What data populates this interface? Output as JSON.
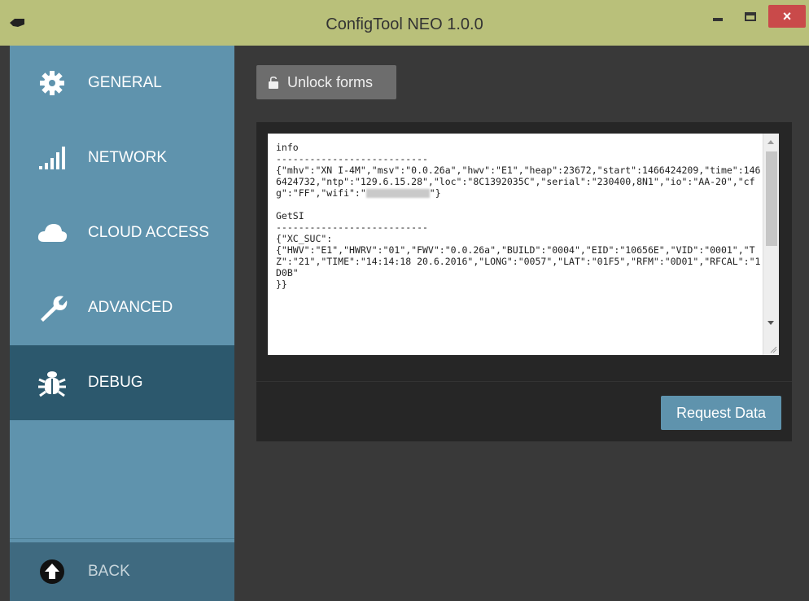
{
  "window": {
    "title": "ConfigTool NEO 1.0.0",
    "close_label": "×",
    "colors": {
      "titlebar": "#b9c07a",
      "sidebar": "#5f93ad",
      "sidebar_active": "#2c586d",
      "main": "#393939",
      "close": "#c94a4a"
    }
  },
  "sidebar": {
    "items": [
      {
        "label": "GENERAL",
        "icon": "gear-icon"
      },
      {
        "label": "NETWORK",
        "icon": "signal-bars-icon"
      },
      {
        "label": "CLOUD ACCESS",
        "icon": "cloud-icon"
      },
      {
        "label": "ADVANCED",
        "icon": "wrench-icon"
      },
      {
        "label": "DEBUG",
        "icon": "bug-icon",
        "active": true
      }
    ],
    "back": {
      "label": "BACK",
      "icon": "arrow-up-circle-icon"
    }
  },
  "main": {
    "unlock_button": {
      "label": "Unlock forms",
      "icon": "lock-icon"
    },
    "debug_output": {
      "line1": "info",
      "line2": "---------------------------",
      "line3a": "{\"mhv\":\"XN I-4M\",\"msv\":\"0.0.26a\",\"hwv\":\"E1\",\"heap\":23672,\"start\":1466424209,\"time\":1466424732,\"ntp\":\"129.6.15.28\",\"loc\":\"8C1392035C\",\"serial\":\"230400,8N1\",\"io\":\"AA-20\",\"cfg\":\"FF\",\"wifi\":\"",
      "line3b": "\"}",
      "line4": "",
      "line5": "GetSI",
      "line6": "---------------------------",
      "line7": "{\"XC_SUC\":",
      "line8": "{\"HWV\":\"E1\",\"HWRV\":\"01\",\"FWV\":\"0.0.26a\",\"BUILD\":\"0004\",\"EID\":\"10656E\",\"VID\":\"0001\",\"TZ\":\"21\",\"TIME\":\"14:14:18 20.6.2016\",\"LONG\":\"0057\",\"LAT\":\"01F5\",\"RFM\":\"0D01\",\"RFCAL\":\"1D0B\"",
      "line9": "}}"
    },
    "request_button": {
      "label": "Request Data"
    }
  }
}
